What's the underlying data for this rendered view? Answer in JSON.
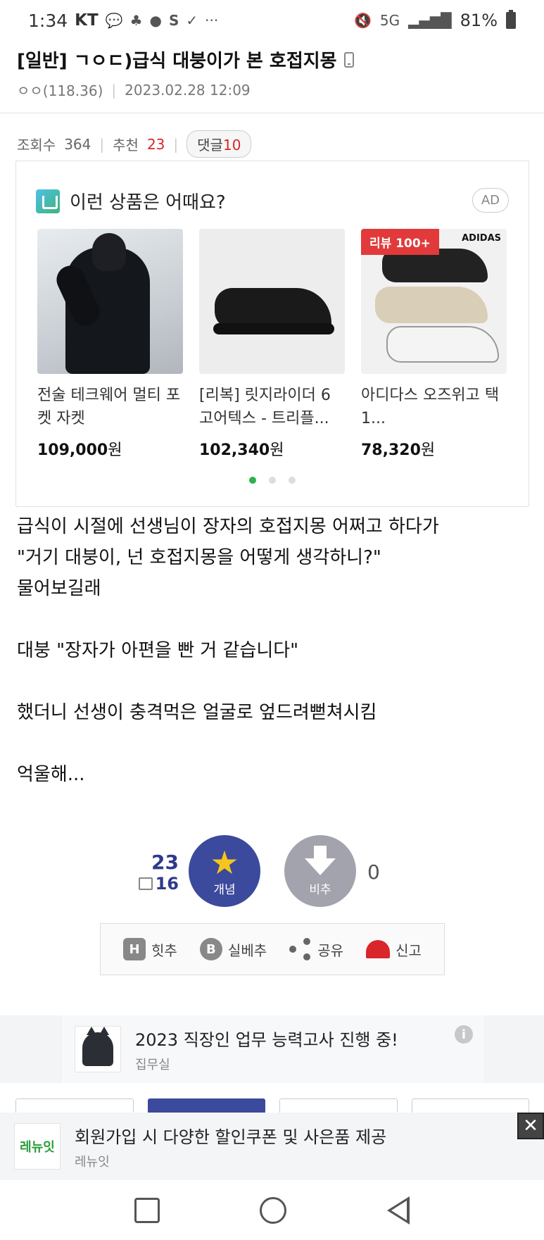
{
  "status_bar": {
    "time": "1:34",
    "carrier": "KT",
    "talk_badge": "TALK",
    "signal_label": "5G",
    "battery": "81%"
  },
  "post": {
    "title": "[일반] ㄱㅇㄷ)급식 대붕이가 본 호접지몽",
    "author": "ㅇㅇ(118.36)",
    "date": "2023.02.28 12:09"
  },
  "stats": {
    "views_label": "조회수",
    "views": "364",
    "recommend_label": "추천",
    "recommend": "23",
    "comments_label": "댓글",
    "comments": "10"
  },
  "ad": {
    "title": "이런 상품은 어때요?",
    "badge": "AD",
    "products": [
      {
        "name": "전술 테크웨어 멀티 포켓 자켓",
        "price": "109,000",
        "unit": "원"
      },
      {
        "name": "[리복] 릿지라이더 6 고어텍스 - 트리플...",
        "price": "102,340",
        "unit": "원"
      },
      {
        "name": "아디다스 오즈위고 택1...",
        "price": "78,320",
        "unit": "원",
        "badge": "리뷰 100+",
        "brand": "ADIDAS"
      }
    ],
    "page_index": 0,
    "page_count": 3
  },
  "body": {
    "lines": [
      "급식이 시절에 선생님이 장자의 호접지몽 어쩌고 하다가",
      "\"거기 대붕이, 넌 호접지몽을 어떻게 생각하니?\"",
      "물어보길래",
      "",
      "대붕 \"장자가 아편을 빤 거 같습니다\"",
      "",
      "했더니 선생이 충격먹은 얼굴로 엎드려뻗쳐시킴",
      "",
      "억울해..."
    ]
  },
  "vote": {
    "up_count": "23",
    "fix_count": "16",
    "up_label": "개념",
    "down_label": "비추",
    "down_count": "0"
  },
  "actions": {
    "hitchu": "힛추",
    "silbechu": "실베추",
    "share": "공유",
    "report": "신고",
    "hit_letter": "H",
    "b_letter": "B"
  },
  "promo": {
    "title": "2023 직장인 업무 능력고사 진행 중!",
    "source": "집무실",
    "info": "i"
  },
  "bottom_ad": {
    "logo_text": "레뉴잇",
    "title": "회원가입 시 다양한 할인쿠폰 및 사은품 제공",
    "source": "레뉴잇",
    "close": "✕"
  },
  "colors": {
    "accent_red": "#d9262b",
    "vote_blue": "#3b4a9c",
    "vote_gray": "#a3a3ae",
    "active_dot": "#2bb24c"
  }
}
